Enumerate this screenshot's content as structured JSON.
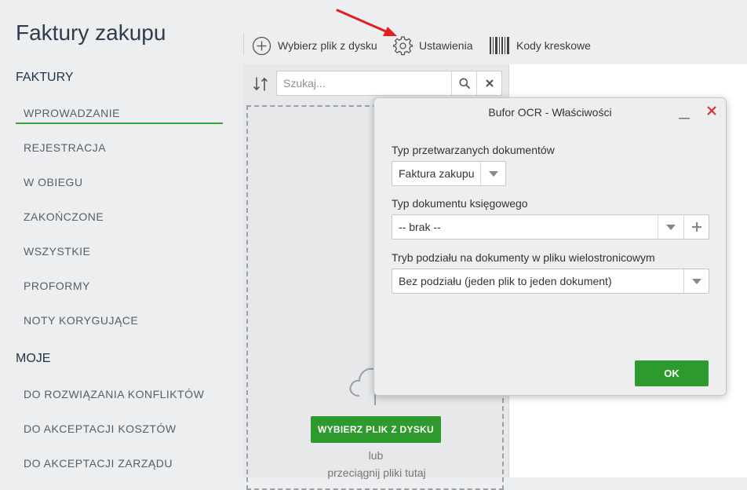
{
  "app": {
    "title": "Faktury zakupu"
  },
  "sidebar": {
    "sections": [
      {
        "title": "FAKTURY"
      },
      {
        "title": "MOJE"
      }
    ],
    "items": [
      {
        "label": "WPROWADZANIE",
        "active": true
      },
      {
        "label": "REJESTRACJA"
      },
      {
        "label": "W OBIEGU"
      },
      {
        "label": "ZAKOŃCZONE"
      },
      {
        "label": "WSZYSTKIE"
      },
      {
        "label": "PROFORMY"
      },
      {
        "label": "NOTY KORYGUJĄCE"
      },
      {
        "label": "DO ROZWIĄZANIA KONFLIKTÓW"
      },
      {
        "label": "DO AKCEPTACJI KOSZTÓW"
      },
      {
        "label": "DO AKCEPTACJI ZARZĄDU"
      }
    ]
  },
  "toolbar": {
    "pick_file_label": "Wybierz plik z dysku",
    "settings_label": "Ustawienia",
    "barcodes_label": "Kody kreskowe"
  },
  "search": {
    "placeholder": "Szukaj...",
    "value": ""
  },
  "dropzone": {
    "button_label": "WYBIERZ PLIK Z DYSKU",
    "or_text": "lub",
    "drag_text": "przeciągnij pliki tutaj"
  },
  "dialog": {
    "title": "Bufor OCR - Właściwości",
    "doc_type_label": "Typ przetwarzanych dokumentów",
    "doc_type_value": "Faktura zakupu",
    "accounting_type_label": "Typ dokumentu księgowego",
    "accounting_type_value": "-- brak --",
    "split_mode_label": "Tryb podziału na dokumenty w pliku wielostronicowym",
    "split_mode_value": "Bez podziału (jeden plik to jeden dokument)",
    "ok_label": "OK"
  },
  "colors": {
    "accent_green": "#2e9a2e",
    "active_underline": "#3aa53a",
    "arrow_red": "#e02020",
    "close_red": "#d9302c"
  }
}
